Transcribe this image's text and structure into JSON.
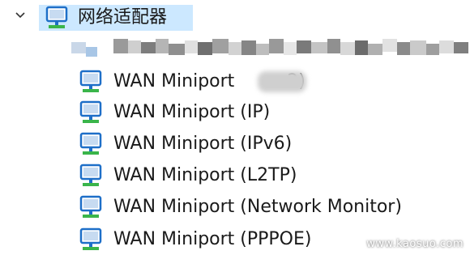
{
  "tree": {
    "category": {
      "label": "网络适配器",
      "icon": "network-adapter-icon",
      "expanded": true
    },
    "devices": [
      {
        "label": "WAN Miniport (    2)",
        "display_prefix": "WAN Miniport ",
        "display_suffix": "2)",
        "icon": "network-adapter-icon",
        "partially_obscured": true
      },
      {
        "label": "WAN Miniport (IP)",
        "icon": "network-adapter-icon"
      },
      {
        "label": "WAN Miniport (IPv6)",
        "icon": "network-adapter-icon"
      },
      {
        "label": "WAN Miniport (L2TP)",
        "icon": "network-adapter-icon"
      },
      {
        "label": "WAN Miniport (Network Monitor)",
        "icon": "network-adapter-icon"
      },
      {
        "label": "WAN Miniport (PPPOE)",
        "icon": "network-adapter-icon"
      }
    ]
  },
  "watermark": "www.kaosuo.com",
  "colors": {
    "selection": "#cce8ff",
    "icon_blue": "#1e6fc8",
    "icon_green": "#3ab54a"
  }
}
